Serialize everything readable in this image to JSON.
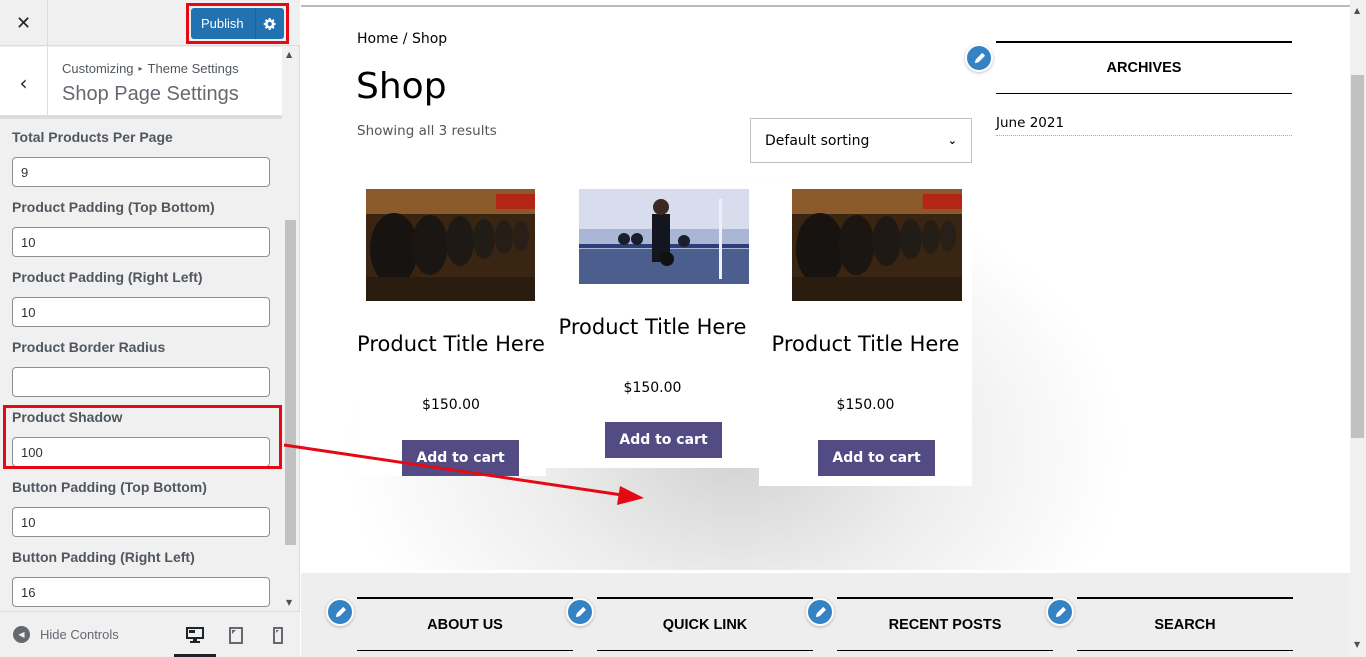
{
  "customizer": {
    "close_icon": "close-icon",
    "publish_label": "Publish",
    "settings_icon": "gear-icon",
    "breadcrumb": {
      "root": "Customizing",
      "separator": "▸",
      "parent": "Theme Settings"
    },
    "section_title": "Shop Page Settings",
    "controls": [
      {
        "label": "Total Products Per Page",
        "value": "9"
      },
      {
        "label": "Product Padding (Top Bottom)",
        "value": "10"
      },
      {
        "label": "Product Padding (Right Left)",
        "value": "10"
      },
      {
        "label": "Product Border Radius",
        "value": ""
      },
      {
        "label": "Product Shadow",
        "value": "100"
      },
      {
        "label": "Button Padding (Top Bottom)",
        "value": "10"
      },
      {
        "label": "Button Padding (Right Left)",
        "value": "16"
      }
    ],
    "footer": {
      "hide_controls_label": "Hide Controls",
      "devices": [
        "desktop",
        "tablet",
        "mobile"
      ],
      "active_device": "desktop"
    }
  },
  "preview": {
    "breadcrumb": "Home / Shop",
    "page_title": "Shop",
    "result_count": "Showing all 3 results",
    "sort": {
      "selected": "Default sorting"
    },
    "products": [
      {
        "title": "Product Title Here",
        "price": "$150.00",
        "button": "Add to cart",
        "image": "dumbbell-rack"
      },
      {
        "title": "Product Title Here",
        "price": "$150.00",
        "button": "Add to cart",
        "image": "woman-gym"
      },
      {
        "title": "Product Title Here",
        "price": "$150.00",
        "button": "Add to cart",
        "image": "dumbbell-rack"
      }
    ],
    "sidebar_widget": {
      "title": "ARCHIVES",
      "items": [
        "June 2021"
      ]
    },
    "footer_widgets": [
      "ABOUT US",
      "QUICK LINK",
      "RECENT POSTS",
      "SEARCH"
    ]
  },
  "colors": {
    "publish": "#2271b1",
    "add_to_cart": "#534b84",
    "edit_shortcut": "#3582c4",
    "annotation": "#e50914"
  }
}
